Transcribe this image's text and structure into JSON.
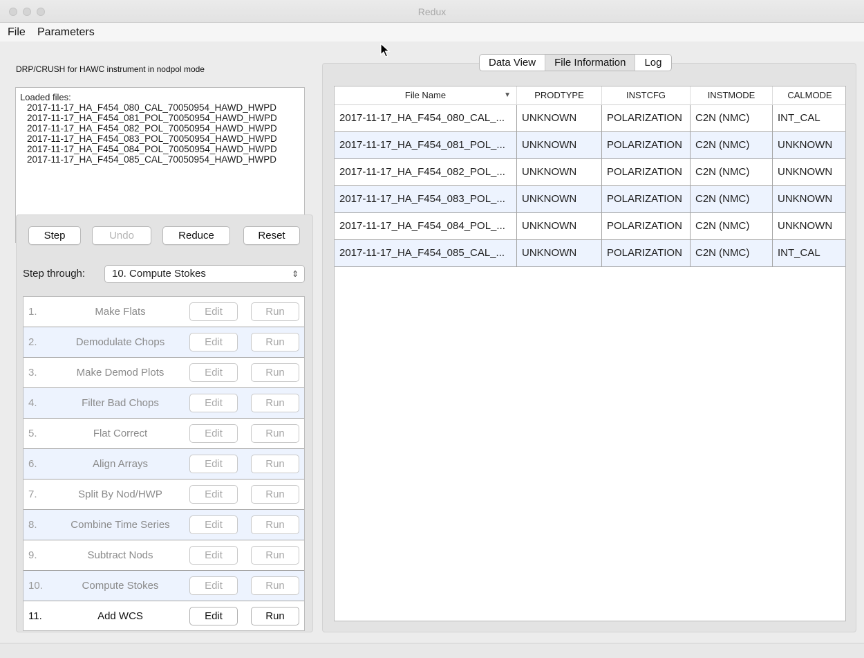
{
  "window": {
    "title": "Redux"
  },
  "menu": {
    "file": "File",
    "parameters": "Parameters"
  },
  "left": {
    "mode_label": "DRP/CRUSH for HAWC instrument in nodpol mode",
    "loaded_title": "Loaded files:",
    "loaded_files": [
      "2017-11-17_HA_F454_080_CAL_70050954_HAWD_HWPD",
      "2017-11-17_HA_F454_081_POL_70050954_HAWD_HWPD",
      "2017-11-17_HA_F454_082_POL_70050954_HAWD_HWPD",
      "2017-11-17_HA_F454_083_POL_70050954_HAWD_HWPD",
      "2017-11-17_HA_F454_084_POL_70050954_HAWD_HWPD",
      "2017-11-17_HA_F454_085_CAL_70050954_HAWD_HWPD"
    ],
    "buttons": {
      "step": "Step",
      "undo": "Undo",
      "reduce": "Reduce",
      "reset": "Reset"
    },
    "step_through_label": "Step through:",
    "step_through_value": "10. Compute Stokes",
    "edit_label": "Edit",
    "run_label": "Run",
    "steps": [
      {
        "num": "1.",
        "name": "Make Flats"
      },
      {
        "num": "2.",
        "name": "Demodulate Chops"
      },
      {
        "num": "3.",
        "name": "Make Demod Plots"
      },
      {
        "num": "4.",
        "name": "Filter Bad Chops"
      },
      {
        "num": "5.",
        "name": "Flat Correct"
      },
      {
        "num": "6.",
        "name": "Align Arrays"
      },
      {
        "num": "7.",
        "name": "Split By Nod/HWP"
      },
      {
        "num": "8.",
        "name": "Combine Time Series"
      },
      {
        "num": "9.",
        "name": "Subtract Nods"
      },
      {
        "num": "10.",
        "name": "Compute Stokes"
      },
      {
        "num": "11.",
        "name": "Add WCS"
      }
    ]
  },
  "right": {
    "tabs": [
      "Data View",
      "File Information",
      "Log"
    ],
    "columns": [
      "File Name",
      "PRODTYPE",
      "INSTCFG",
      "INSTMODE",
      "CALMODE"
    ],
    "rows": [
      [
        "2017-11-17_HA_F454_080_CAL_...",
        "UNKNOWN",
        "POLARIZATION",
        "C2N (NMC)",
        "INT_CAL"
      ],
      [
        "2017-11-17_HA_F454_081_POL_...",
        "UNKNOWN",
        "POLARIZATION",
        "C2N (NMC)",
        "UNKNOWN"
      ],
      [
        "2017-11-17_HA_F454_082_POL_...",
        "UNKNOWN",
        "POLARIZATION",
        "C2N (NMC)",
        "UNKNOWN"
      ],
      [
        "2017-11-17_HA_F454_083_POL_...",
        "UNKNOWN",
        "POLARIZATION",
        "C2N (NMC)",
        "UNKNOWN"
      ],
      [
        "2017-11-17_HA_F454_084_POL_...",
        "UNKNOWN",
        "POLARIZATION",
        "C2N (NMC)",
        "UNKNOWN"
      ],
      [
        "2017-11-17_HA_F454_085_CAL_...",
        "UNKNOWN",
        "POLARIZATION",
        "C2N (NMC)",
        "INT_CAL"
      ]
    ]
  }
}
